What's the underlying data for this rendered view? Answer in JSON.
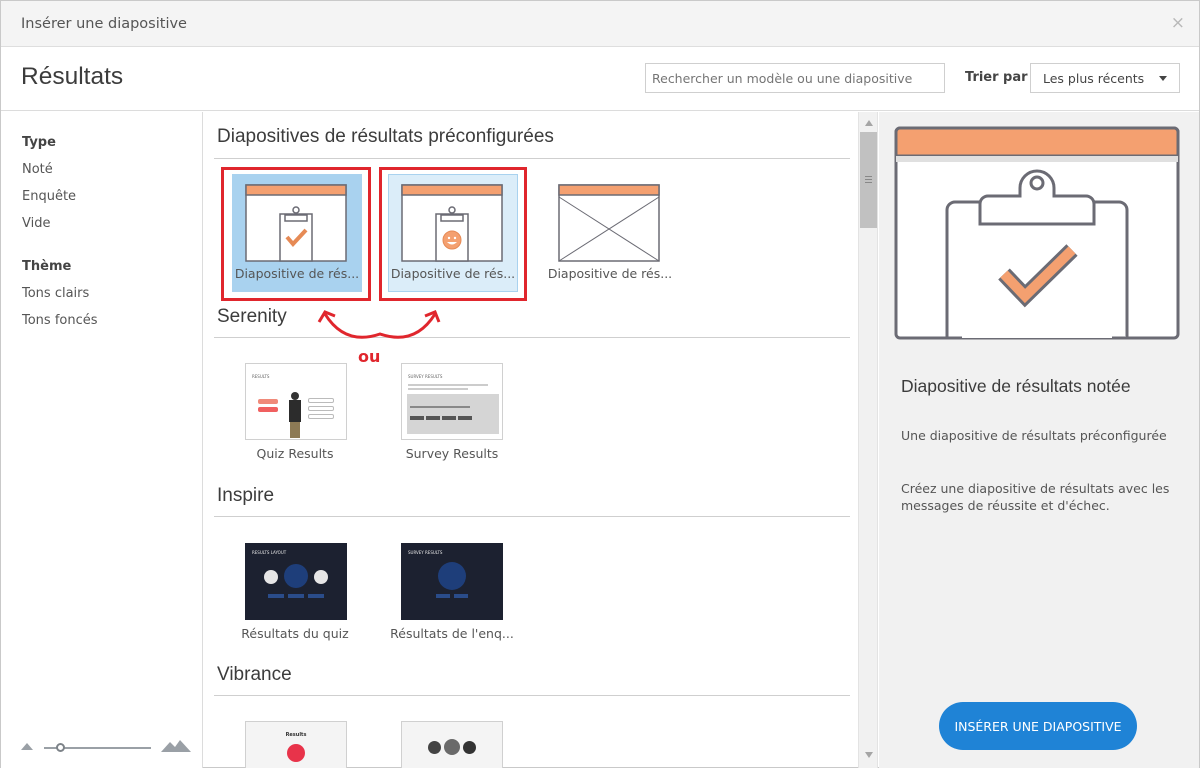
{
  "window": {
    "title": "Insérer une diapositive",
    "close_glyph": "×"
  },
  "header": {
    "heading": "Résultats",
    "search_placeholder": "Rechercher un modèle ou une diapositive",
    "sort_label": "Trier par :",
    "sort_value": "Les plus récents"
  },
  "sidebar": {
    "type_title": "Type",
    "type_items": [
      "Noté",
      "Enquête",
      "Vide"
    ],
    "theme_title": "Thème",
    "theme_items": [
      "Tons clairs",
      "Tons foncés"
    ]
  },
  "sections": {
    "preconfigured": {
      "title": "Diapositives de résultats préconfigurées",
      "tiles": [
        "Diapositive de rés...",
        "Diapositive de rés...",
        "Diapositive de rés..."
      ]
    },
    "serenity": {
      "title": "Serenity",
      "tiles": [
        "Quiz Results",
        "Survey Results"
      ],
      "thumb_text": {
        "quiz_title": "RESULTS",
        "survey_title": "SURVEY RESULTS"
      }
    },
    "inspire": {
      "title": "Inspire",
      "tiles": [
        "Résultats du quiz",
        "Résultats de l'enq..."
      ],
      "thumb_text": {
        "quiz_title": "RESULTS LAYOUT",
        "survey_title": "SURVEY RESULTS"
      }
    },
    "vibrance": {
      "title": "Vibrance",
      "thumb_text": {
        "quiz_title": "Results"
      }
    }
  },
  "annotation": {
    "label": "ou",
    "color": "#e0262d"
  },
  "preview": {
    "title": "Diapositive de résultats notée",
    "subtitle": "Une diapositive de résultats préconfigurée",
    "description": "Créez une diapositive de résultats avec les messages de réussite et d'échec.",
    "insert_label": "INSÉRER UNE DIAPOSITIVE"
  },
  "colors": {
    "accent": "#1f83d6",
    "selection": "#a9d2ef",
    "hover": "#dbedf9",
    "orange": "#f4a070",
    "annotation_red": "#e0262d"
  },
  "icons": [
    "close-icon",
    "chevron-down-icon",
    "clipboard-check-icon",
    "clipboard-smiley-icon",
    "blank-slide-icon",
    "small-mountain-icon",
    "large-mountain-icon"
  ]
}
